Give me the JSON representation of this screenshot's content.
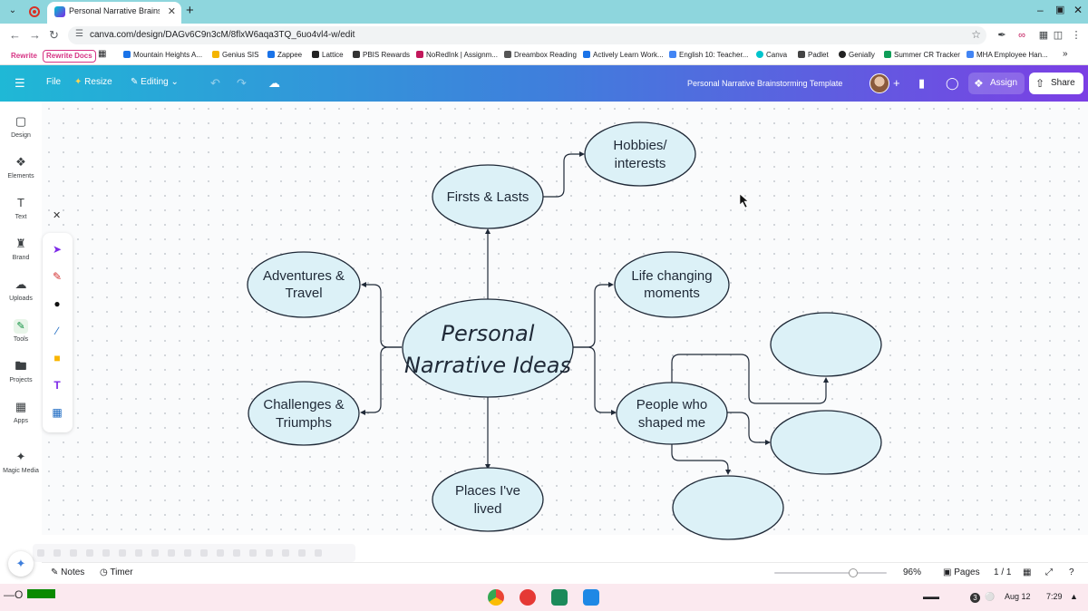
{
  "browser": {
    "tab_title": "Personal Narrative Brainstorming",
    "url": "canva.com/design/DAGv6C9n3cM/8flxW6aqa3TQ_6uo4vl4-w/edit"
  },
  "bookmarks": [
    {
      "label": "Rewrite",
      "pill": true
    },
    {
      "label": "Rewrite Docs",
      "pill": true
    },
    {
      "label": "Mountain Heights A...",
      "color": "#1a73e8"
    },
    {
      "label": "Genius SIS",
      "color": "#f4b400"
    },
    {
      "label": "Zappee",
      "color": "#1a73e8"
    },
    {
      "label": "Lattice",
      "color": "#222222"
    },
    {
      "label": "PBIS Rewards",
      "color": "#333333"
    },
    {
      "label": "NoRedInk | Assignm...",
      "color": "#c2185b"
    },
    {
      "label": "Dreambox Reading",
      "color": "#555555"
    },
    {
      "label": "Actively Learn Work...",
      "color": "#1a73e8"
    },
    {
      "label": "English 10: Teacher...",
      "color": "#4285f4"
    },
    {
      "label": "Canva",
      "color": "#00c4cc"
    },
    {
      "label": "Padlet",
      "color": "#444444"
    },
    {
      "label": "Genially",
      "color": "#222222"
    },
    {
      "label": "Summer CR Tracker",
      "color": "#0f9d58"
    },
    {
      "label": "MHA Employee Han...",
      "color": "#4285f4"
    }
  ],
  "header": {
    "file_label": "File",
    "resize_label": "Resize",
    "editing_label": "Editing",
    "doc_title": "Personal Narrative Brainstorming Template",
    "assign_label": "Assign",
    "share_label": "Share"
  },
  "sidebar": {
    "items": [
      {
        "label": "Design",
        "icon": "design-icon"
      },
      {
        "label": "Elements",
        "icon": "elements-icon"
      },
      {
        "label": "Text",
        "icon": "text-icon"
      },
      {
        "label": "Brand",
        "icon": "brand-icon"
      },
      {
        "label": "Uploads",
        "icon": "uploads-icon"
      },
      {
        "label": "Tools",
        "icon": "tools-icon"
      },
      {
        "label": "Projects",
        "icon": "projects-icon"
      },
      {
        "label": "Apps",
        "icon": "apps-icon"
      },
      {
        "label": "Magic Media",
        "icon": "magic-media-icon"
      }
    ]
  },
  "mindmap": {
    "center": [
      "Personal",
      "Narrative Ideas"
    ],
    "firsts_lasts": "Firsts & Lasts",
    "hobbies": [
      "Hobbies/",
      "interests"
    ],
    "adventures": [
      "Adventures &",
      "Travel"
    ],
    "life_changing": [
      "Life changing",
      "moments"
    ],
    "challenges": [
      "Challenges &",
      "Triumphs"
    ],
    "people": [
      "People who",
      "shaped me"
    ],
    "places": [
      "Places I've",
      "lived"
    ]
  },
  "footer": {
    "notes_label": "Notes",
    "timer_label": "Timer",
    "zoom": "96%",
    "pages_label": "Pages",
    "page_counter": "1 / 1"
  },
  "shelf": {
    "date": "Aug 12",
    "time": "7:29",
    "notif_count": "3"
  },
  "colors": {
    "node_fill": "#dcf1f7",
    "header_gradient_start": "#1fb8d6",
    "header_gradient_end": "#7b3fe4"
  }
}
